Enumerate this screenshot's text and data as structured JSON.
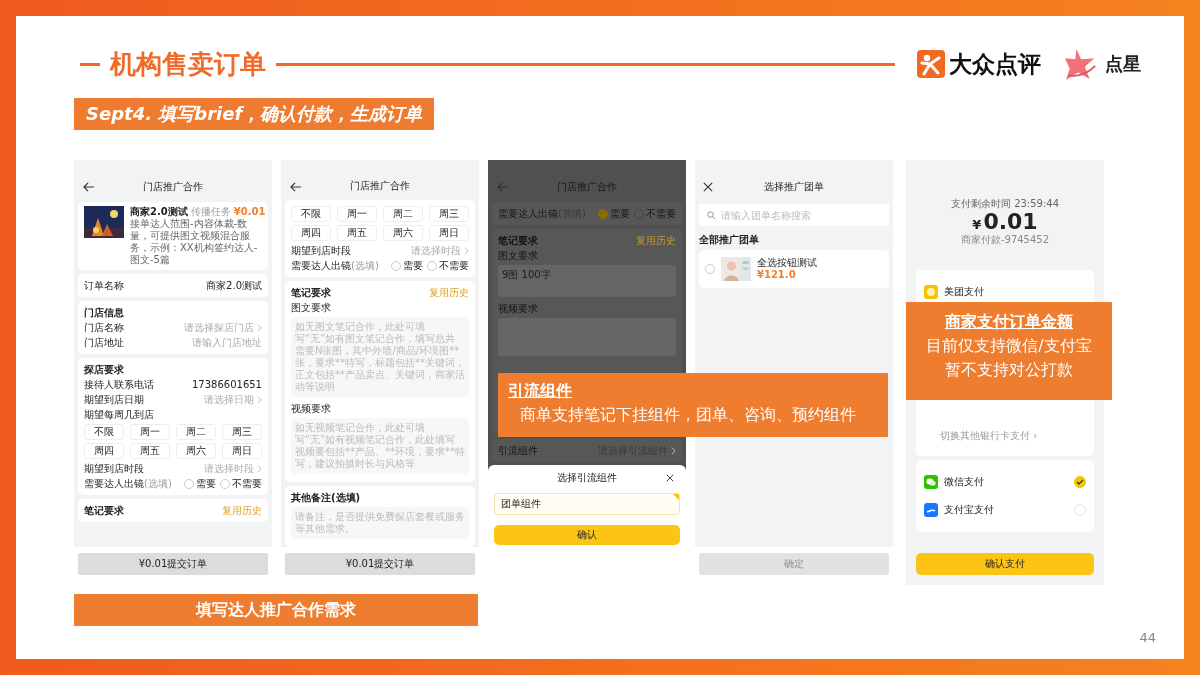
{
  "slide": {
    "title": "机构售卖订单",
    "subtitle": "Sept4. 填写brief，确认付款，生成订单",
    "page_number": "44"
  },
  "logos": [
    {
      "kind": "dianping",
      "text": "大众点评"
    },
    {
      "kind": "dianxing",
      "text": "点星"
    }
  ],
  "phones": [
    {
      "shade": false,
      "blocks": [
        {
          "kind": "back_header",
          "title": "门店推广合作"
        },
        {
          "kind": "product",
          "title": "商家2.0测试",
          "tag": "传播任务",
          "price": "¥0.01",
          "description": "接单达人范围-内容体裁-数量，可提供图文视频混合服务，示例：XX机构签约达人-图文-5篇"
        },
        {
          "kind": "card",
          "items": [
            {
              "kind": "row",
              "label": "订单名称",
              "value": "商家2.0测试"
            }
          ]
        },
        {
          "kind": "card",
          "title": "门店信息",
          "items": [
            {
              "kind": "picker",
              "label": "门店名称",
              "hint": "请选择探店门店"
            },
            {
              "kind": "input",
              "label": "门店地址",
              "hint": "请输入门店地址"
            }
          ]
        },
        {
          "kind": "card",
          "title": "探店要求",
          "items": [
            {
              "kind": "row",
              "label": "接待人联系电话",
              "value": "17386601651"
            },
            {
              "kind": "picker",
              "label": "期望到店日期",
              "hint": "请选择日期"
            },
            {
              "kind": "label",
              "text": "期望每周几到店"
            },
            {
              "kind": "chips",
              "options": [
                "不限",
                "周一",
                "周二",
                "周三",
                "周四",
                "周五",
                "周六",
                "周日"
              ]
            },
            {
              "kind": "picker",
              "label": "期望到店时段",
              "hint": "请选择时段"
            },
            {
              "kind": "radio_row",
              "label": "需要达人出镜",
              "note": "(选填)",
              "options": [
                {
                  "label": "需要",
                  "selected": false
                },
                {
                  "label": "不需要",
                  "selected": false
                }
              ]
            }
          ]
        },
        {
          "kind": "card",
          "title": "笔记要求",
          "action": "复用历史"
        }
      ],
      "footer": {
        "label": "¥0.01提交订单",
        "kind": "plain",
        "disabled": false
      }
    },
    {
      "shade": false,
      "blocks": [
        {
          "kind": "back_header",
          "title": "门店推广合作"
        },
        {
          "kind": "card",
          "items": [
            {
              "kind": "chips",
              "options": [
                "不限",
                "周一",
                "周二",
                "周三",
                "周四",
                "周五",
                "周六",
                "周日"
              ]
            },
            {
              "kind": "picker",
              "label": "期望到店时段",
              "hint": "请选择时段"
            },
            {
              "kind": "radio_row",
              "label": "需要达人出镜",
              "note": "(选填)",
              "options": [
                {
                  "label": "需要",
                  "selected": false
                },
                {
                  "label": "不需要",
                  "selected": false
                }
              ]
            }
          ]
        },
        {
          "kind": "card",
          "title": "笔记要求",
          "action": "复用历史",
          "items": [
            {
              "kind": "label",
              "text": "图文要求"
            },
            {
              "kind": "textarea",
              "placeholder": "如无图文笔记合作，此处可填写“无”如有图文笔记合作，填写总共需要N张图，其中外墙/商品/环境图**张，要求**特写，标题包括**关键词，正文包括**产品卖点、关键词，商家活动等说明"
            },
            {
              "kind": "label",
              "text": "视频要求"
            },
            {
              "kind": "textarea",
              "placeholder": "如无视频笔记合作，此处可填写“无”如有视频笔记合作，此处填写视频要包括**产品、**环境，要求**特写，建议拍摄时长与风格等"
            }
          ]
        },
        {
          "kind": "card",
          "title": "其他备注(选填)",
          "items": [
            {
              "kind": "textarea",
              "placeholder": "请备注，是否提供免费探店套餐或服务等其他需求。"
            }
          ]
        }
      ],
      "footer": {
        "label": "¥0.01提交订单",
        "kind": "plain",
        "disabled": false
      }
    },
    {
      "shade": true,
      "blocks": [
        {
          "kind": "back_header",
          "title": "门店推广合作"
        },
        {
          "kind": "card",
          "items": [
            {
              "kind": "radio_row",
              "label": "需要达人出镜",
              "note": "(选填)",
              "options": [
                {
                  "label": "需要",
                  "selected": true
                },
                {
                  "label": "不需要",
                  "selected": false
                }
              ]
            }
          ]
        },
        {
          "kind": "card",
          "title": "笔记要求",
          "action": "复用历史",
          "items": [
            {
              "kind": "label",
              "text": "图文要求"
            },
            {
              "kind": "textarea",
              "value": "9图 100字"
            },
            {
              "kind": "label",
              "text": "视频要求"
            },
            {
              "kind": "textarea"
            }
          ]
        },
        {
          "kind": "card",
          "items": [
            {
              "kind": "picker",
              "label": "引流组件",
              "hint": "请选择引流组件"
            }
          ]
        }
      ],
      "sheet": {
        "title": "选择引流组件",
        "options": [
          {
            "label": "团单组件",
            "selected": true
          }
        ],
        "button": "确认"
      }
    },
    {
      "shade": false,
      "blocks": [
        {
          "kind": "close_header",
          "title": "选择推广团单"
        },
        {
          "kind": "search",
          "placeholder": "请输入团单名称搜索"
        },
        {
          "kind": "section",
          "text": "全部推广团单"
        },
        {
          "kind": "deal",
          "title": "全选按钮测试",
          "price": "¥121.0",
          "selected": false
        }
      ],
      "footer": {
        "label": "确定",
        "kind": "plain",
        "disabled": true
      }
    },
    {
      "shade": false,
      "blocks": [
        {
          "kind": "payhead",
          "timer": "支付剩余时间 23:59:44",
          "currency": "¥",
          "amount": "0.01",
          "payee": "商家付款-9745452"
        },
        {
          "kind": "paycard",
          "items": [
            {
              "kind": "method",
              "name": "美团支付"
            },
            {
              "kind": "link",
              "text": "切换其他银行卡支付 ›"
            }
          ]
        },
        {
          "kind": "paycard",
          "items": [
            {
              "kind": "method",
              "name": "微信支付",
              "selected": true
            },
            {
              "kind": "method",
              "name": "支付宝支付",
              "selected": false
            }
          ]
        }
      ],
      "footer": {
        "label": "确认支付",
        "kind": "primary",
        "disabled": false
      }
    }
  ],
  "callouts": [
    {
      "title": "引流组件",
      "lines": [
        "商单支持笔记下挂组件，团单、咨询、预约组件"
      ]
    },
    {
      "title": "商家支付订单金额",
      "lines": [
        "目前仅支持微信/支付宝",
        "暂不支持对公打款"
      ]
    }
  ],
  "caption": "填写达人推广合作需求"
}
